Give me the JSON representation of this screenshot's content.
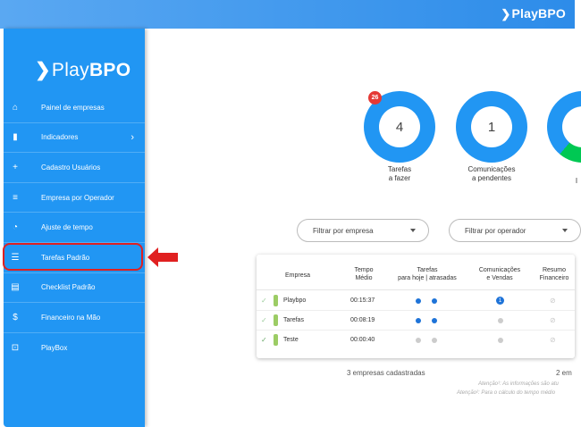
{
  "header": {
    "logo_chevron": "❯",
    "logo_text": "PlayBPO"
  },
  "sidebar": {
    "logo_chevron": "❯",
    "logo_play": "Play",
    "logo_bpo": "BPO",
    "items": [
      {
        "label": "Painel de empresas",
        "icon": "home-icon",
        "glyph": "⌂"
      },
      {
        "label": "Indicadores",
        "icon": "bar-chart-icon",
        "glyph": "▮",
        "arrow": "›"
      },
      {
        "label": "Cadastro Usuários",
        "icon": "add-user-icon",
        "glyph": "+"
      },
      {
        "label": "Empresa por Operador",
        "icon": "sliders-icon",
        "glyph": "≡"
      },
      {
        "label": "Ajuste de tempo",
        "icon": "timer-icon",
        "glyph": "◔"
      },
      {
        "label": "Tarefas Padrão",
        "icon": "checklist-icon",
        "glyph": "☰"
      },
      {
        "label": "Checklist Padrão",
        "icon": "list-box-icon",
        "glyph": "▤"
      },
      {
        "label": "Financeiro na Mão",
        "icon": "money-icon",
        "glyph": "$"
      },
      {
        "label": "PlayBox",
        "icon": "gift-box-icon",
        "glyph": "⊡"
      }
    ]
  },
  "summary": {
    "tasks": {
      "value": "4",
      "badge": "26",
      "label_line1": "Tarefas",
      "label_line2": "a fazer"
    },
    "comms": {
      "value": "1",
      "label_line1": "Comunicações",
      "label_line2": "a pendentes"
    },
    "third_label": "I"
  },
  "filters": {
    "company": "Filtrar por empresa",
    "operator": "Filtrar por operador"
  },
  "table": {
    "headers": {
      "empresa": "Empresa",
      "tempo_1": "Tempo",
      "tempo_2": "Médio",
      "tarefas_1": "Tarefas",
      "tarefas_2": "para hoje | atrasadas",
      "comun_1": "Comunicações",
      "comun_2": "e Vendas",
      "resumo_1": "Resumo",
      "resumo_2": "Financeiro"
    },
    "rows": [
      {
        "name": "Playbpo",
        "time": "00:15:37",
        "comm": "1",
        "check": "✓",
        "eye": "⊘"
      },
      {
        "name": "Tarefas",
        "time": "00:08:19",
        "check": "✓",
        "eye": "⊘"
      },
      {
        "name": "Teste",
        "time": "00:00:40",
        "check": "✓",
        "eye": "⊘"
      }
    ]
  },
  "footer": {
    "count": "3 empresas cadastradas",
    "count2": "2 em",
    "note1": "Atenção¹: As informações são atu",
    "note2": "Atenção²: Para o cálculo do tempo médio"
  },
  "colors": {
    "primary": "#2196f3",
    "highlight": "#e02020",
    "green": "#00c853"
  }
}
